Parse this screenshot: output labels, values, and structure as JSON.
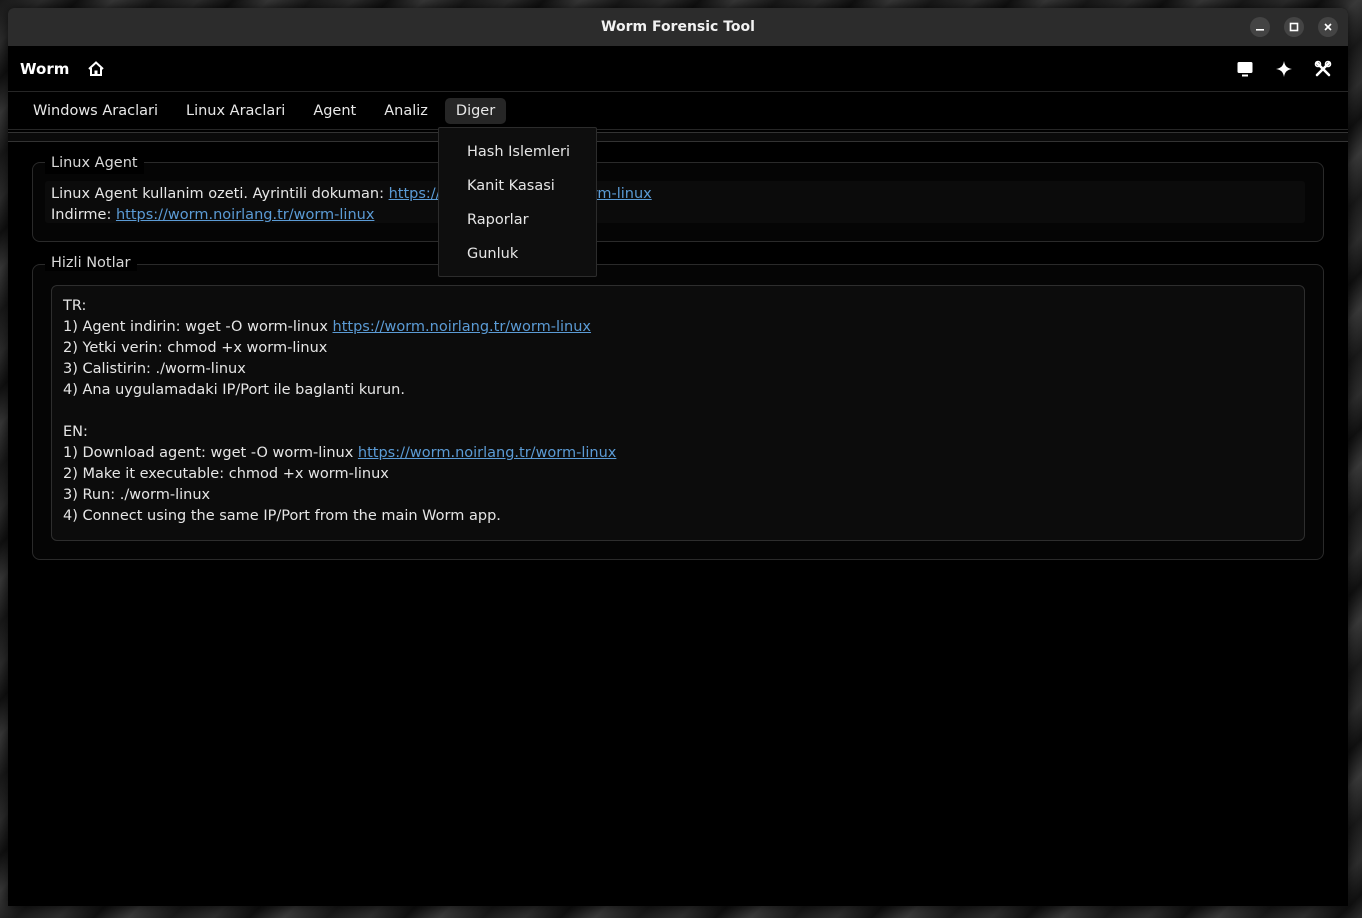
{
  "window": {
    "title": "Worm Forensic Tool",
    "controls": [
      "minimize-icon",
      "maximize-icon",
      "close-icon"
    ]
  },
  "toolbar": {
    "app_name": "Worm",
    "left_icons": [
      "home-icon"
    ],
    "right_icons": [
      "monitor-icon",
      "sparkle-icon",
      "tools-icon"
    ]
  },
  "menubar": {
    "items": [
      {
        "label": "Windows Araclari"
      },
      {
        "label": "Linux Araclari"
      },
      {
        "label": "Agent"
      },
      {
        "label": "Analiz"
      },
      {
        "label": "Diger",
        "active": true
      }
    ]
  },
  "dropdown": {
    "items": [
      {
        "label": "Hash Islemleri"
      },
      {
        "label": "Kanit Kasasi"
      },
      {
        "label": "Raporlar"
      },
      {
        "label": "Gunluk"
      }
    ]
  },
  "linux_agent": {
    "title": "Linux Agent",
    "summary_text": "Linux Agent kullanim ozeti. Ayrintili dokuman: ",
    "summary_link_start": "https://g",
    "summary_link_end": "orm-linux",
    "download_text": "Indirme: ",
    "download_link": "https://worm.noirlang.tr/worm-linux"
  },
  "quick_notes": {
    "title": "Hizli Notlar",
    "lines": [
      {
        "text": "TR:"
      },
      {
        "text": "1) Agent indirin: wget -O worm-linux ",
        "link": "https://worm.noirlang.tr/worm-linux"
      },
      {
        "text": "2) Yetki verin: chmod +x worm-linux"
      },
      {
        "text": "3) Calistirin: ./worm-linux"
      },
      {
        "text": "4) Ana uygulamadaki IP/Port ile baglanti kurun."
      },
      {
        "text": ""
      },
      {
        "text": "EN:"
      },
      {
        "text": "1) Download agent: wget -O worm-linux ",
        "link": "https://worm.noirlang.tr/worm-linux"
      },
      {
        "text": "2) Make it executable: chmod +x worm-linux"
      },
      {
        "text": "3) Run: ./worm-linux"
      },
      {
        "text": "4) Connect using the same IP/Port from the main Worm app."
      }
    ]
  },
  "colors": {
    "link": "#5b9bd5",
    "background": "#000000",
    "titlebar": "#2c2c2c"
  }
}
